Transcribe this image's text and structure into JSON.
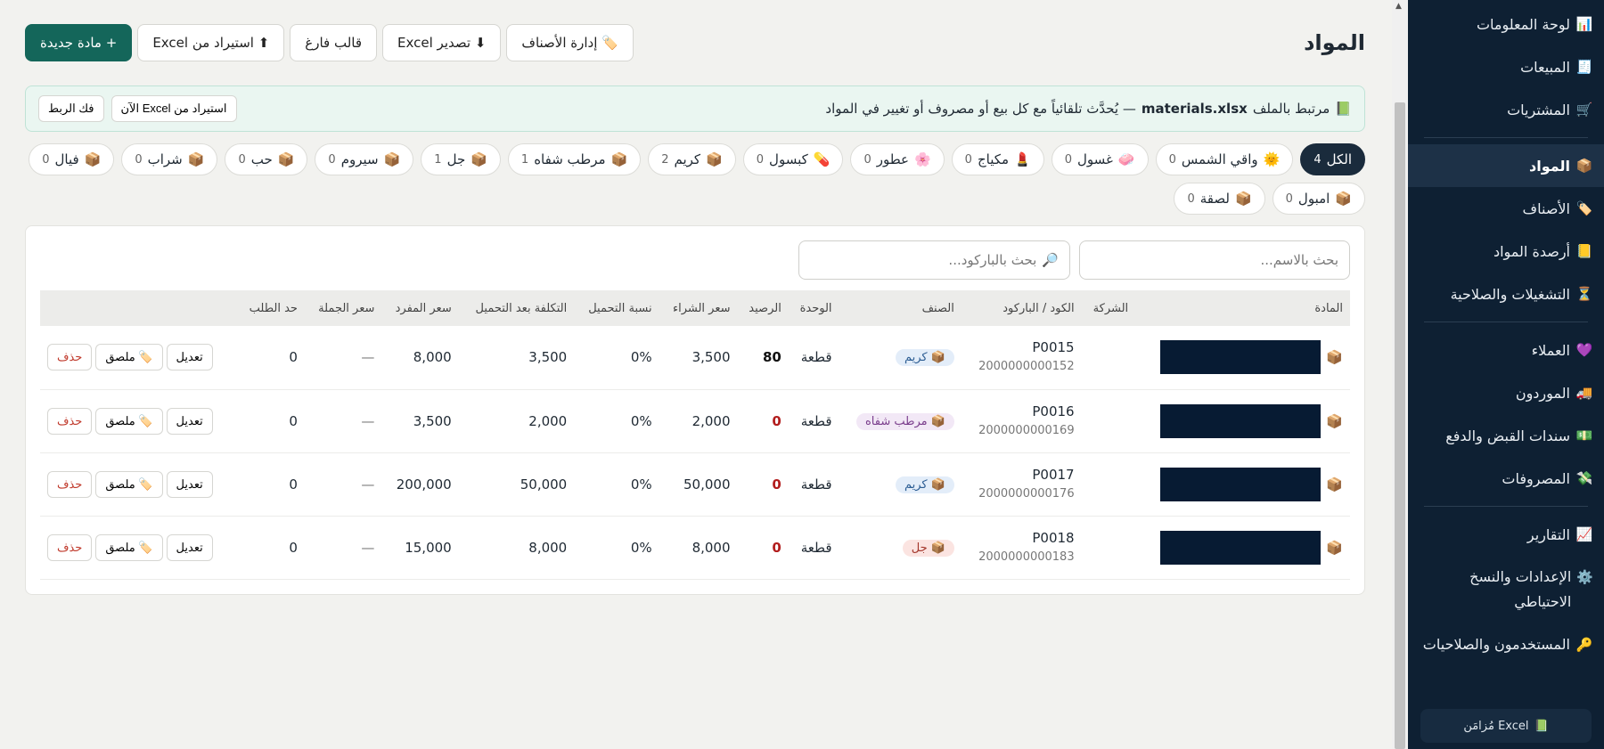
{
  "sidebar": {
    "items": [
      {
        "icon": "📊",
        "icon_name": "chart-icon",
        "label": "لوحة المعلومات"
      },
      {
        "icon": "🧾",
        "icon_name": "receipt-icon",
        "label": "المبيعات"
      },
      {
        "icon": "🛒",
        "icon_name": "cart-icon",
        "label": "المشتريات"
      },
      {
        "icon": "📦",
        "icon_name": "box-icon",
        "label": "المواد"
      },
      {
        "icon": "🏷️",
        "icon_name": "tag-icon",
        "label": "الأصناف"
      },
      {
        "icon": "📒",
        "icon_name": "ledger-icon",
        "label": "أرصدة المواد"
      },
      {
        "icon": "⏳",
        "icon_name": "hourglass-icon",
        "label": "التشغيلات والصلاحية"
      },
      {
        "icon": "💜",
        "icon_name": "heart-icon",
        "label": "العملاء"
      },
      {
        "icon": "🚚",
        "icon_name": "truck-icon",
        "label": "الموردون"
      },
      {
        "icon": "💵",
        "icon_name": "cash-icon",
        "label": "سندات القبض والدفع"
      },
      {
        "icon": "💸",
        "icon_name": "money-wings-icon",
        "label": "المصروفات"
      },
      {
        "icon": "📈",
        "icon_name": "trend-icon",
        "label": "التقارير"
      },
      {
        "icon": "⚙️",
        "icon_name": "gear-icon",
        "label": "الإعدادات والنسخ الاحتياطي"
      },
      {
        "icon": "🔑",
        "icon_name": "key-icon",
        "label": "المستخدمون والصلاحيات"
      }
    ],
    "active": "المواد",
    "excel_status": "Excel مُزامَن",
    "excel_icon": "📗"
  },
  "header": {
    "title": "المواد",
    "buttons": {
      "manage_categories": "🏷️ إدارة الأصناف",
      "export_excel": "⬇ تصدير Excel",
      "blank_template": "قالب فارغ",
      "import_excel": "⬆ استيراد من Excel",
      "new_material": "+ مادة جديدة"
    }
  },
  "banner": {
    "icon": "📗",
    "prefix": "مرتبط بالملف",
    "file": "materials.xlsx",
    "suffix": "— يُحدَّث تلقائياً مع كل بيع أو مصروف أو تغيير في المواد",
    "import_now": "استيراد من Excel الآن",
    "unlink": "فك الربط"
  },
  "filters": [
    {
      "icon": "",
      "label": "الكل",
      "count": "4",
      "active": true
    },
    {
      "icon": "🌞",
      "label": "واقي الشمس",
      "count": "0"
    },
    {
      "icon": "🧼",
      "label": "غسول",
      "count": "0"
    },
    {
      "icon": "💄",
      "label": "مكياج",
      "count": "0"
    },
    {
      "icon": "🌸",
      "label": "عطور",
      "count": "0"
    },
    {
      "icon": "💊",
      "label": "كبسول",
      "count": "0"
    },
    {
      "icon": "📦",
      "label": "كريم",
      "count": "2"
    },
    {
      "icon": "📦",
      "label": "مرطب شفاه",
      "count": "1"
    },
    {
      "icon": "📦",
      "label": "جل",
      "count": "1"
    },
    {
      "icon": "📦",
      "label": "سيروم",
      "count": "0"
    },
    {
      "icon": "📦",
      "label": "حب",
      "count": "0"
    },
    {
      "icon": "📦",
      "label": "شراب",
      "count": "0"
    },
    {
      "icon": "📦",
      "label": "فيال",
      "count": "0"
    },
    {
      "icon": "📦",
      "label": "امبول",
      "count": "0"
    },
    {
      "icon": "📦",
      "label": "لصقة",
      "count": "0"
    }
  ],
  "search": {
    "name_placeholder": "بحث بالاسم...",
    "barcode_placeholder": "بحث بالباركود...",
    "barcode_icon": "🔎"
  },
  "table": {
    "headers": [
      "المادة",
      "الشركة",
      "الكود / الباركود",
      "الصنف",
      "الوحدة",
      "الرصيد",
      "سعر الشراء",
      "نسبة التحميل",
      "التكلفة بعد التحميل",
      "سعر المفرد",
      "سعر الجملة",
      "حد الطلب",
      ""
    ],
    "rows": [
      {
        "code": "P0015",
        "barcode": "2000000000152",
        "category": "كريم",
        "tag_color": "blue",
        "unit": "قطعة",
        "balance": "80",
        "balance_state": "pos",
        "purchase": "3,500",
        "load_pct": "0%",
        "cost_after": "3,500",
        "retail": "8,000",
        "wholesale": "—",
        "reorder": "0"
      },
      {
        "code": "P0016",
        "barcode": "2000000000169",
        "category": "مرطب شفاه",
        "tag_color": "purple",
        "unit": "قطعة",
        "balance": "0",
        "balance_state": "zero",
        "purchase": "2,000",
        "load_pct": "0%",
        "cost_after": "2,000",
        "retail": "3,500",
        "wholesale": "—",
        "reorder": "0"
      },
      {
        "code": "P0017",
        "barcode": "2000000000176",
        "category": "كريم",
        "tag_color": "blue",
        "unit": "قطعة",
        "balance": "0",
        "balance_state": "zero",
        "purchase": "50,000",
        "load_pct": "0%",
        "cost_after": "50,000",
        "retail": "200,000",
        "wholesale": "—",
        "reorder": "0"
      },
      {
        "code": "P0018",
        "barcode": "2000000000183",
        "category": "جل",
        "tag_color": "pink",
        "unit": "قطعة",
        "balance": "0",
        "balance_state": "zero",
        "purchase": "8,000",
        "load_pct": "0%",
        "cost_after": "8,000",
        "retail": "15,000",
        "wholesale": "—",
        "reorder": "0"
      }
    ],
    "row_icon": "📦",
    "actions": {
      "edit": "تعديل",
      "label": "🏷️ ملصق",
      "delete": "حذف"
    }
  }
}
